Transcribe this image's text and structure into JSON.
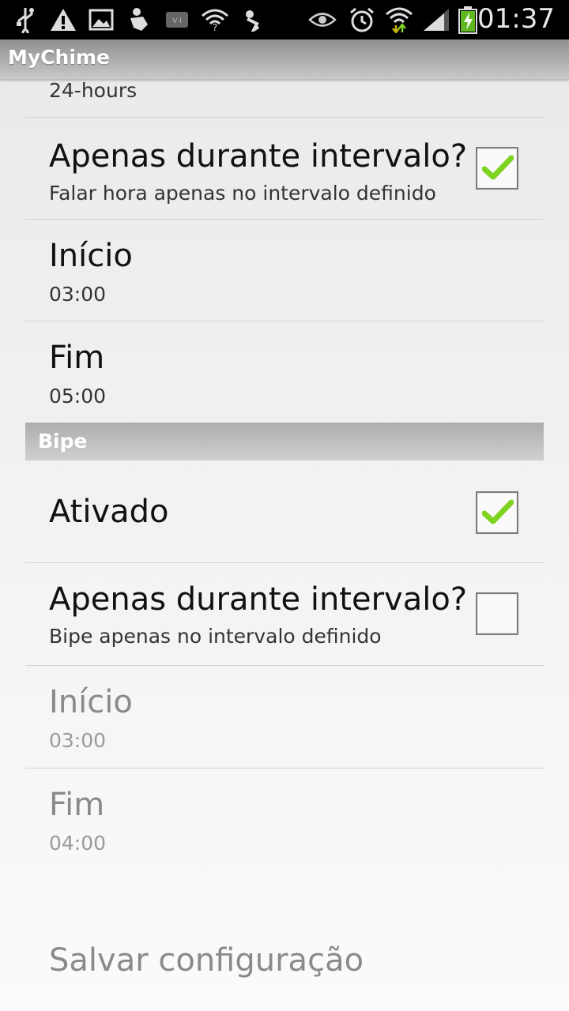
{
  "status_bar": {
    "time": "01:37",
    "left_icons": [
      "usb-icon",
      "warning-icon",
      "gallery-icon",
      "notification-app-icon",
      "voicemail-icon",
      "wifi-question-icon",
      "download-icon"
    ],
    "right_icons": [
      "eye-icon",
      "alarm-icon",
      "wifi-icon",
      "signal-icon",
      "battery-charging-icon"
    ]
  },
  "app": {
    "title": "MyChime"
  },
  "speech": {
    "format_summary": "24-hours",
    "interval_only": {
      "title": "Apenas durante intervalo?",
      "summary": "Falar hora apenas no intervalo definido",
      "checked": true
    },
    "start": {
      "title": "Início",
      "value": "03:00"
    },
    "end": {
      "title": "Fim",
      "value": "05:00"
    }
  },
  "beep": {
    "category": "Bipe",
    "enabled": {
      "title": "Ativado",
      "checked": true
    },
    "interval_only": {
      "title": "Apenas durante intervalo?",
      "summary": "Bipe apenas no intervalo definido",
      "checked": false
    },
    "start": {
      "title": "Início",
      "value": "03:00"
    },
    "end": {
      "title": "Fim",
      "value": "04:00"
    }
  },
  "save_label": "Salvar configuração",
  "colors": {
    "status_bar": "#000000",
    "check_green": "#7ed321",
    "disabled_text": "#8a8a8a"
  }
}
